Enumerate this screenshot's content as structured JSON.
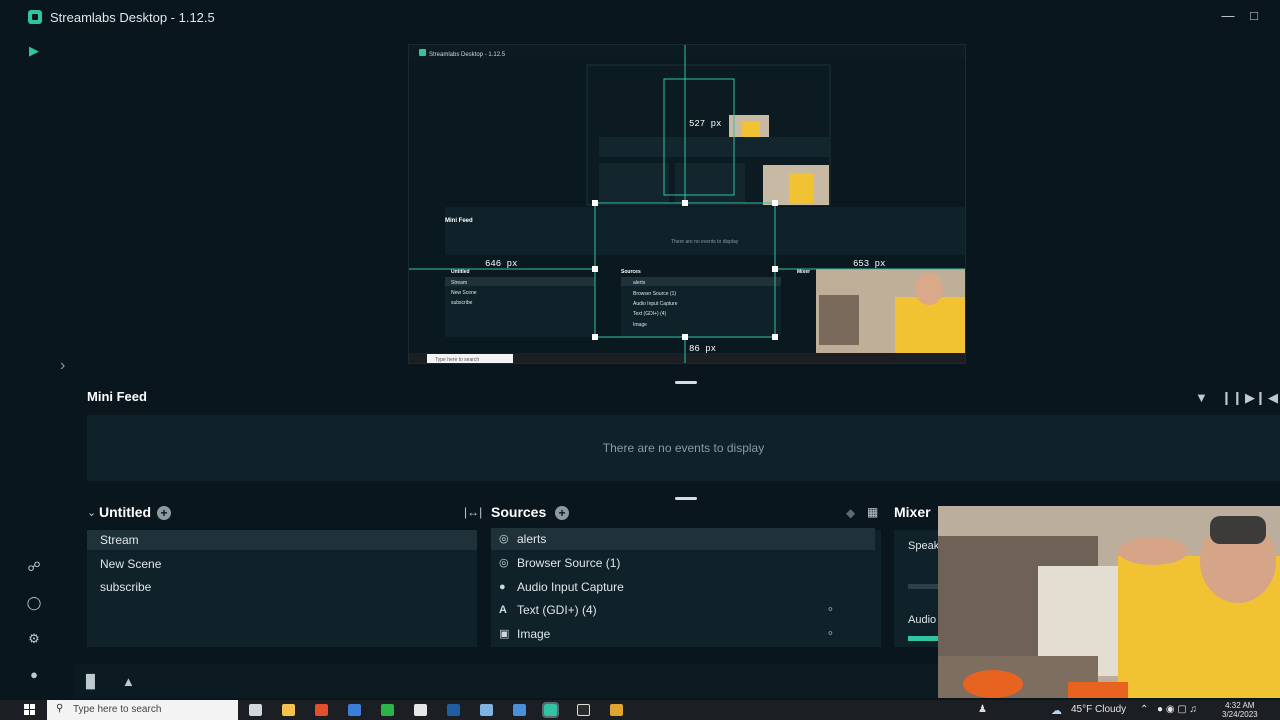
{
  "window": {
    "title": "Streamlabs Desktop - 1.12.5",
    "controls": [
      "minimize",
      "maximize"
    ]
  },
  "canvas": {
    "measurements": [
      "527 px",
      "646 px",
      "653 px",
      "86 px"
    ],
    "nested_title": "Streamlabs Desktop - 1.12.5",
    "nested_minifeed": "Mini Feed",
    "nested_empty": "There are no events to display",
    "nested_scenes": [
      "Stream",
      "New Scene",
      "subscribe"
    ],
    "nested_sources": [
      "alerts",
      "Browser Source (1)",
      "Audio Input Capture",
      "Text (GDI+) (4)",
      "Image"
    ],
    "nested_scene_title": "Untitled",
    "nested_sources_title": "Sources",
    "nested_mixer_title": "Mixer",
    "nested_search": "Type here to search"
  },
  "mini_feed": {
    "title": "Mini Feed",
    "empty_text": "There are no events to display"
  },
  "scenes": {
    "title": "Untitled",
    "items": [
      "Stream",
      "New Scene",
      "subscribe"
    ],
    "selected": "Stream"
  },
  "sources": {
    "title": "Sources",
    "items": [
      {
        "label": "alerts",
        "icon": "globe-icon"
      },
      {
        "label": "Browser Source (1)",
        "icon": "globe-icon"
      },
      {
        "label": "Audio Input Capture",
        "icon": "microphone-icon"
      },
      {
        "label": "Text (GDI+) (4)",
        "icon": "text-icon"
      },
      {
        "label": "Image",
        "icon": "image-icon"
      }
    ]
  },
  "mixer": {
    "title": "Mixer",
    "items": [
      "Speak",
      "Audio"
    ]
  },
  "taskbar": {
    "search_placeholder": "Type here to search",
    "weather": "45°F  Cloudy",
    "time": "4:32 AM",
    "date": "3/24/2023"
  },
  "colors": {
    "accent": "#31c3a2",
    "background": "#09161d",
    "panel": "#0f2129",
    "selected": "#1f3139"
  }
}
